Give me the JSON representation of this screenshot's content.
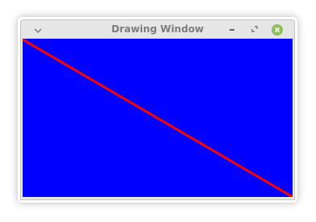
{
  "window": {
    "title": "Drawing Window"
  },
  "titlebar": {
    "icons": {
      "menu": "chevron-down-icon",
      "minimize": "minimize-icon",
      "maximize": "maximize-icon",
      "close": "close-icon"
    }
  },
  "colors": {
    "canvas_background": "#0000ff",
    "line": "#ff0000",
    "close_button": "#8dbf5a",
    "titlebar": "#e6e6e6",
    "title_text": "#7d7d7d"
  }
}
